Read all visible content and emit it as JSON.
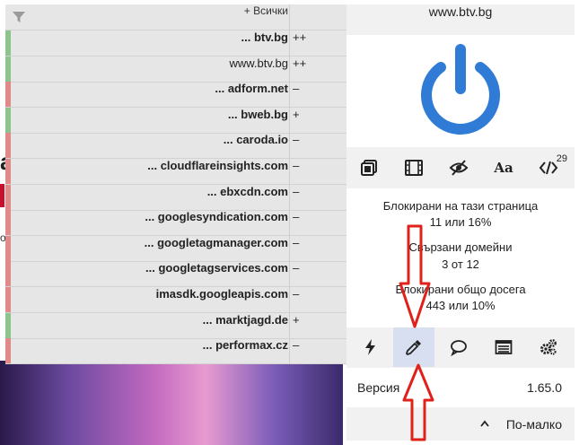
{
  "filter_panel": {
    "all_label": "+ Всички",
    "rows": [
      {
        "name": "... btv.bg",
        "mark": "++",
        "bar": "green",
        "bold": true
      },
      {
        "name": "www.btv.bg",
        "mark": "++",
        "bar": "green",
        "bold": false
      },
      {
        "name": "... adform.net",
        "mark": "–",
        "bar": "red",
        "bold": true
      },
      {
        "name": "... bweb.bg",
        "mark": "+",
        "bar": "green",
        "bold": true
      },
      {
        "name": "... caroda.io",
        "mark": "–",
        "bar": "red",
        "bold": true
      },
      {
        "name": "... cloudflareinsights.com",
        "mark": "–",
        "bar": "red",
        "bold": true
      },
      {
        "name": "... ebxcdn.com",
        "mark": "–",
        "bar": "red",
        "bold": true
      },
      {
        "name": "... googlesyndication.com",
        "mark": "–",
        "bar": "red",
        "bold": true
      },
      {
        "name": "... googletagmanager.com",
        "mark": "–",
        "bar": "red",
        "bold": true
      },
      {
        "name": "... googletagservices.com",
        "mark": "–",
        "bar": "red",
        "bold": true
      },
      {
        "name": "imasdk.googleapis.com",
        "mark": "–",
        "bar": "red",
        "bold": true
      },
      {
        "name": "... marktjagd.de",
        "mark": "+",
        "bar": "green",
        "bold": true
      },
      {
        "name": "... performax.cz",
        "mark": "–",
        "bar": "red",
        "bold": true
      }
    ]
  },
  "main": {
    "hostname": "www.btv.bg",
    "power_color": "#2f7bd6",
    "tools": {
      "font_label": "Aa",
      "script_count": "29"
    },
    "stats": [
      {
        "label": "Блокирани на тази страница",
        "value": "11 или 16%"
      },
      {
        "label": "Свързани домейни",
        "value": "3 от 12"
      },
      {
        "label": "Блокирани общо досега",
        "value": "443 или 10%"
      }
    ],
    "version_label": "Версия",
    "version_value": "1.65.0",
    "less_label": "По-малко"
  },
  "icons": [
    "filter-icon",
    "power-icon",
    "popup-block-icon",
    "media-icon",
    "eye-slash-icon",
    "font-icon",
    "code-icon",
    "lightning-icon",
    "eyedropper-icon",
    "chat-icon",
    "list-icon",
    "gears-icon",
    "chevron-up-icon"
  ],
  "colors": {
    "accent": "#2f7bd6",
    "allow": "#8dc48d",
    "block": "#e08a8a",
    "annotation": "#e0211b"
  }
}
